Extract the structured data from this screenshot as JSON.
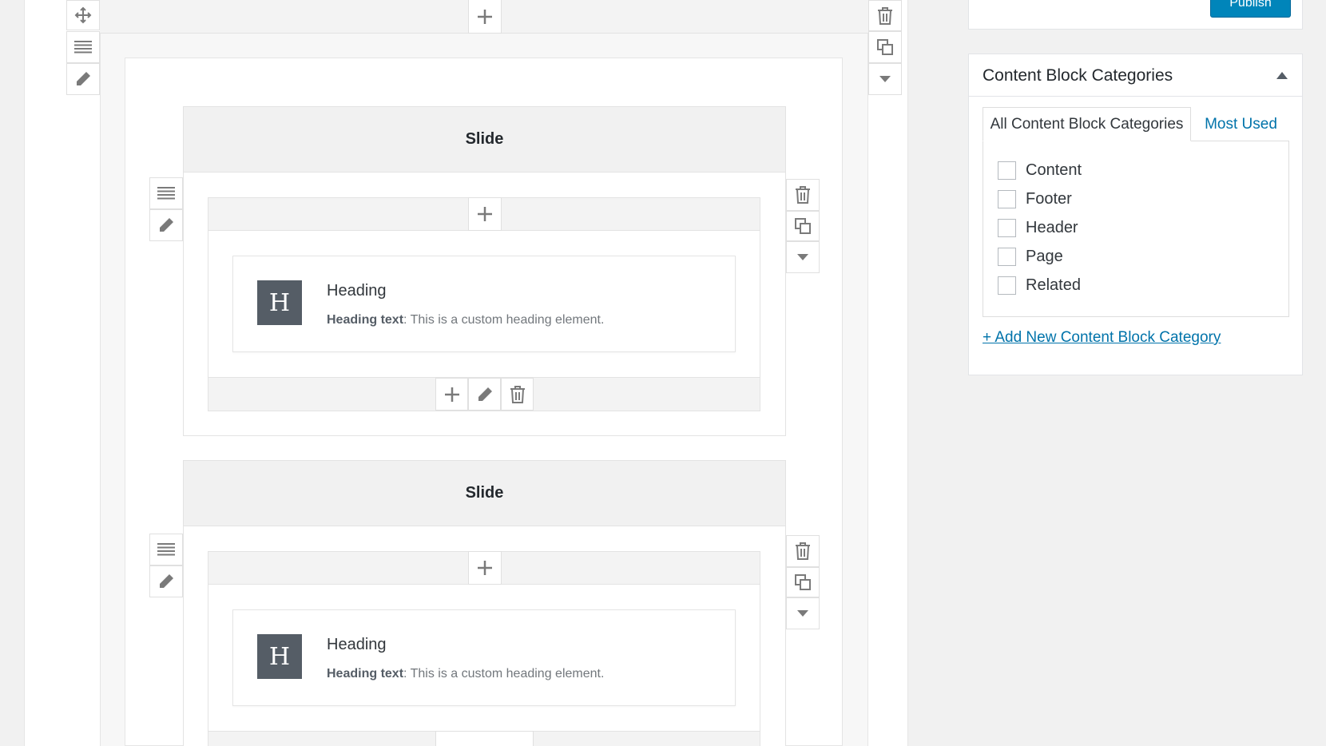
{
  "sidebar": {
    "publish_label": "Publish",
    "categories_box": {
      "title": "Content Block Categories",
      "tabs": [
        {
          "label": "All Content Block Categories",
          "active": true
        },
        {
          "label": "Most Used",
          "active": false
        }
      ],
      "items": [
        {
          "label": "Content",
          "checked": false
        },
        {
          "label": "Footer",
          "checked": false
        },
        {
          "label": "Header",
          "checked": false
        },
        {
          "label": "Page",
          "checked": false
        },
        {
          "label": "Related",
          "checked": false
        }
      ],
      "add_link": "+ Add New Content Block Category"
    }
  },
  "builder": {
    "slides": [
      {
        "title": "Slide",
        "element": {
          "badge": "H",
          "name": "Heading",
          "desc_label": "Heading text",
          "desc_text": ": This is a custom heading element."
        }
      },
      {
        "title": "Slide",
        "element": {
          "badge": "H",
          "name": "Heading",
          "desc_label": "Heading text",
          "desc_text": ": This is a custom heading element."
        }
      }
    ]
  },
  "icons": {
    "move": "move-icon",
    "rows": "rows-icon",
    "edit": "pencil-icon",
    "add": "plus-icon",
    "delete": "trash-icon",
    "duplicate": "duplicate-icon",
    "collapse": "caret-down-icon",
    "toggle": "caret-up-icon"
  },
  "colors": {
    "accent": "#0073aa",
    "publish_bg": "#0085ba",
    "badge": "#555d66"
  }
}
